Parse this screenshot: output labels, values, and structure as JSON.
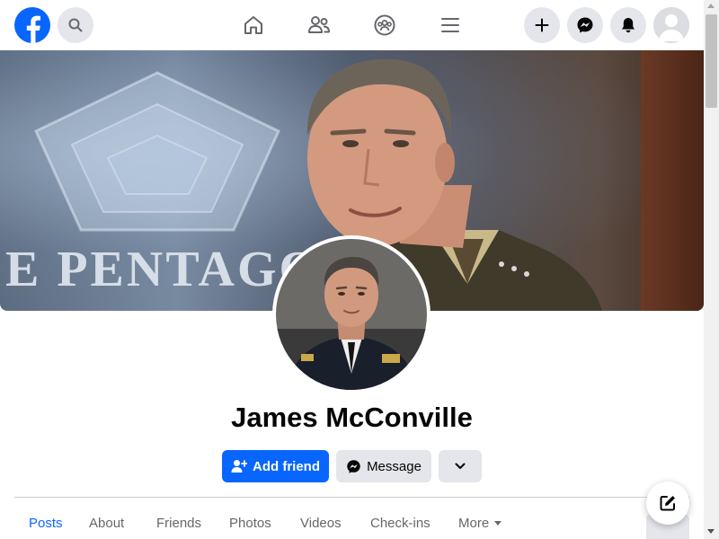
{
  "profile": {
    "name": "James McConville",
    "cover_caption": "E PENTAGON"
  },
  "actions": {
    "add_friend_label": "Add friend",
    "message_label": "Message"
  },
  "tabs": [
    {
      "label": "Posts",
      "active": true
    },
    {
      "label": "About",
      "active": false
    },
    {
      "label": "Friends",
      "active": false
    },
    {
      "label": "Photos",
      "active": false
    },
    {
      "label": "Videos",
      "active": false
    },
    {
      "label": "Check-ins",
      "active": false
    },
    {
      "label": "More",
      "active": false
    }
  ],
  "icons": {
    "logo": "facebook-logo-icon",
    "search": "search-icon",
    "home": "home-icon",
    "friends": "friends-icon",
    "groups": "groups-icon",
    "menu": "menu-icon",
    "create": "plus-icon",
    "messenger": "messenger-icon",
    "notifications": "bell-icon",
    "account": "avatar-icon",
    "compose": "compose-icon"
  },
  "colors": {
    "brand": "#0866ff",
    "button_secondary": "#e4e6eb",
    "text_primary": "#050505",
    "text_secondary": "#65676b"
  }
}
